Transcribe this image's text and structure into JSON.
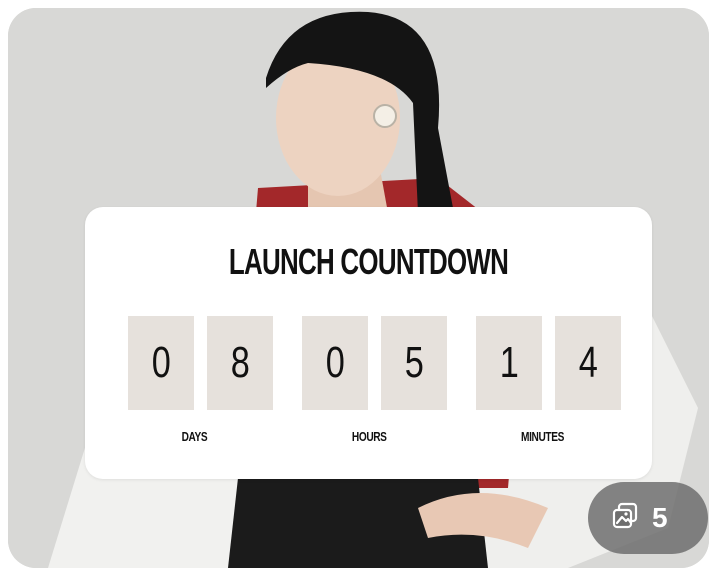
{
  "countdown": {
    "title": "LAUNCH COUNTDOWN",
    "days": [
      "0",
      "8"
    ],
    "hours": [
      "0",
      "5"
    ],
    "minutes": [
      "1",
      "4"
    ],
    "labels": {
      "days": "DAYS",
      "hours": "HOURS",
      "minutes": "MINUTES"
    }
  },
  "gallery_badge": {
    "icon": "gallery-icon",
    "count": "5"
  },
  "colors": {
    "panel": "#ffffff",
    "digit_tile": "#e6e1dc",
    "text": "#111111",
    "badge": "#6e6e6e"
  }
}
